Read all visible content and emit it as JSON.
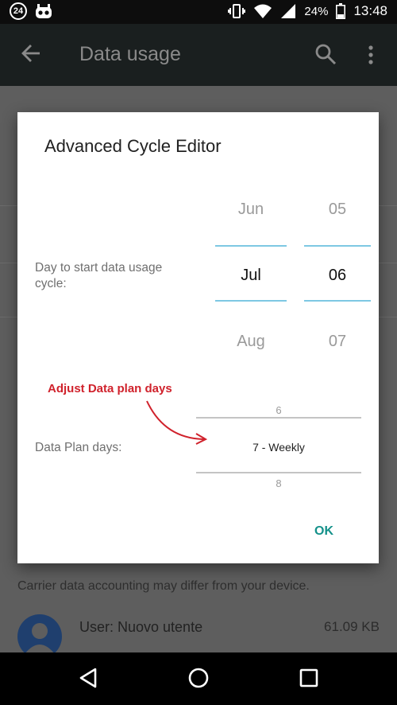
{
  "status_bar": {
    "notification_badge": "24",
    "battery_percent": "24%",
    "time": "13:48",
    "icons": [
      "calendar-24-icon",
      "app-icon",
      "vibrate-icon",
      "wifi-icon",
      "signal-icon",
      "battery-icon"
    ]
  },
  "app_bar": {
    "title": "Data usage",
    "icons": [
      "arrow-left-icon",
      "search-icon",
      "more-vert-icon"
    ]
  },
  "background": {
    "carrier_note": "Carrier data accounting may differ from your device.",
    "user_row": {
      "name": "User: Nuovo utente",
      "size": "61.09 KB"
    }
  },
  "dialog": {
    "title": "Advanced Cycle Editor",
    "cycle_start": {
      "label": "Day to start data usage cycle:",
      "month_picker": {
        "prev": "Jun",
        "selected": "Jul",
        "next": "Aug"
      },
      "day_picker": {
        "prev": "05",
        "selected": "06",
        "next": "07"
      }
    },
    "annotation": "Adjust Data plan days",
    "plan_days": {
      "label": "Data Plan days:",
      "prev": "6",
      "selected": "7 - Weekly",
      "next": "8"
    },
    "ok_label": "OK"
  },
  "colors": {
    "accent": "#14918a",
    "picker_divider": "#7ec8e3",
    "annotation": "#d0222c"
  }
}
